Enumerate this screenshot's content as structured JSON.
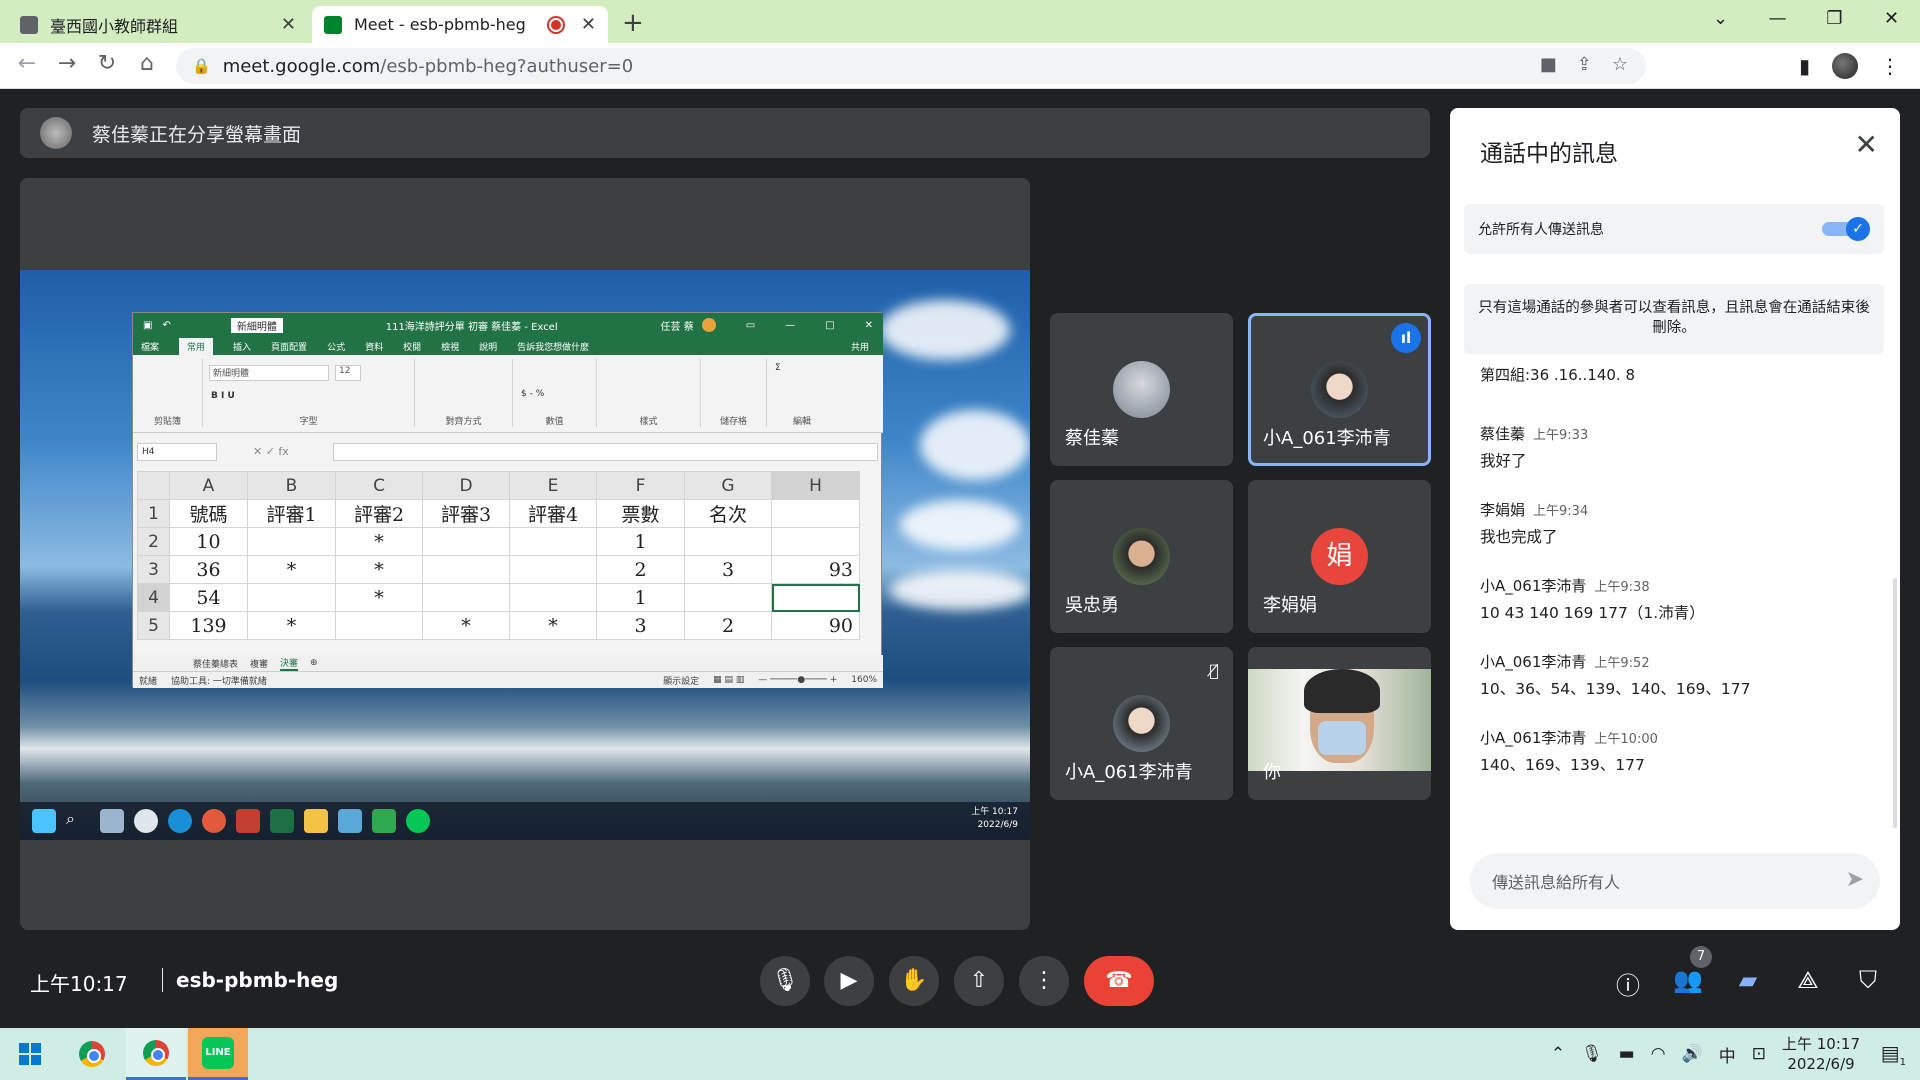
{
  "browser": {
    "tabs": [
      {
        "title": "臺西國小教師群組",
        "favicon_color": "#5f6368"
      },
      {
        "title": "Meet - esb-pbmb-heg",
        "favicon_color": "#00832d",
        "recording": true
      }
    ],
    "url_host": "meet.google.com",
    "url_path": "/esb-pbmb-heg?authuser=0"
  },
  "meet": {
    "presenter_banner": "蔡佳蓁正在分享螢幕畫面",
    "tiles": [
      {
        "name": "蔡佳蓁"
      },
      {
        "name": "小A_061李沛青",
        "speaking": true
      },
      {
        "name": "吳忠勇"
      },
      {
        "name": "李娟娟",
        "initial": "娟"
      },
      {
        "name": "小A_061李沛青",
        "muted": true
      },
      {
        "name": "你"
      }
    ],
    "clock": "上午10:17",
    "meeting_code": "esb-pbmb-heg",
    "participant_count": "7"
  },
  "shared_excel": {
    "title": "111海洋詩評分單 初審 蔡佳蓁 - Excel",
    "user": "任芸 蔡",
    "ribbon_tabs": [
      "檔案",
      "常用",
      "插入",
      "頁面配置",
      "公式",
      "資料",
      "校閱",
      "檢視",
      "說明",
      "告訴我您想做什麼",
      "共用"
    ],
    "font_name": "新細明體",
    "font_size": "12",
    "ribbon_groups": [
      "剪貼簿",
      "字型",
      "對齊方式",
      "數值",
      "樣式",
      "儲存格",
      "編輯"
    ],
    "name_box": "H4",
    "columns": [
      "A",
      "B",
      "C",
      "D",
      "E",
      "F",
      "G",
      "H"
    ],
    "rows": [
      {
        "n": "1",
        "cells": [
          "號碼",
          "評審1",
          "評審2",
          "評審3",
          "評審4",
          "票數",
          "名次",
          ""
        ]
      },
      {
        "n": "2",
        "cells": [
          "10",
          "",
          "*",
          "",
          "",
          "1",
          "",
          ""
        ]
      },
      {
        "n": "3",
        "cells": [
          "36",
          "*",
          "*",
          "",
          "",
          "2",
          "3",
          "93"
        ]
      },
      {
        "n": "4",
        "cells": [
          "54",
          "",
          "*",
          "",
          "",
          "1",
          "",
          ""
        ]
      },
      {
        "n": "5",
        "cells": [
          "139",
          "*",
          "",
          "*",
          "*",
          "3",
          "2",
          "90"
        ]
      }
    ],
    "sheets": [
      "蔡佳蓁總表",
      "複審",
      "決審"
    ],
    "status_left": "就緒",
    "status_accessibility": "協助工具: 一切準備就緒",
    "status_display": "顯示設定",
    "zoom": "160%",
    "inner_clock_time": "上午 10:17",
    "inner_clock_date": "2022/6/9"
  },
  "chat": {
    "title": "通話中的訊息",
    "allow_label": "允許所有人傳送訊息",
    "allow_enabled": true,
    "notice": "只有這場通話的參與者可以查看訊息，且訊息會在通話結束後刪除。",
    "partial_message": "第四組:36 .16..140. 8",
    "messages": [
      {
        "sender": "蔡佳蓁",
        "time": "上午9:33",
        "text": "我好了"
      },
      {
        "sender": "李娟娟",
        "time": "上午9:34",
        "text": "我也完成了"
      },
      {
        "sender": "小A_061李沛青",
        "time": "上午9:38",
        "text": "10 43 140 169 177（1.沛青）"
      },
      {
        "sender": "小A_061李沛青",
        "time": "上午9:52",
        "text": "10、36、54、139、140、169、177"
      },
      {
        "sender": "小A_061李沛青",
        "time": "上午10:00",
        "text": "140、169、139、177"
      }
    ],
    "compose_placeholder": "傳送訊息給所有人"
  },
  "windows": {
    "time": "上午 10:17",
    "date": "2022/6/9",
    "ime": "中",
    "line_label": "LINE",
    "notification_count": "1"
  },
  "colors": {
    "meet_bg": "#202124",
    "tab_strip": "#d3edc0",
    "end_call": "#ea4335",
    "accent_blue": "#1a73e8",
    "excel_green": "#217346"
  }
}
